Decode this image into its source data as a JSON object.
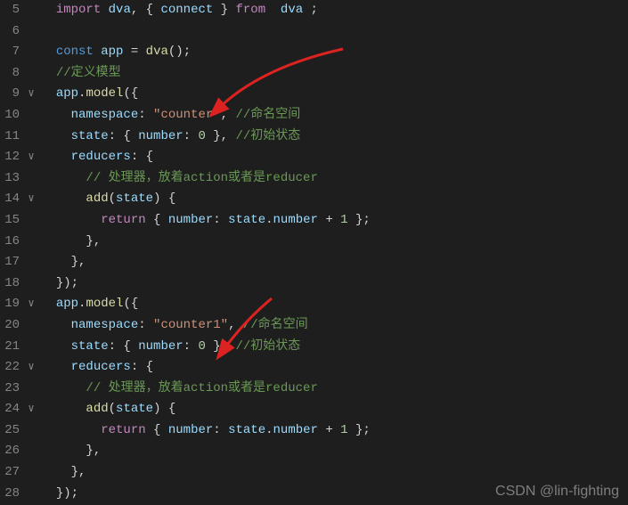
{
  "watermark": "CSDN @lin-fighting",
  "lines": [
    {
      "num": "5",
      "fold": "",
      "tokens": [
        {
          "cls": "",
          "t": "  "
        },
        {
          "cls": "kw-import",
          "t": "import"
        },
        {
          "cls": "",
          "t": " "
        },
        {
          "cls": "var",
          "t": "dva"
        },
        {
          "cls": "punct",
          "t": ", { "
        },
        {
          "cls": "var",
          "t": "connect"
        },
        {
          "cls": "punct",
          "t": " } "
        },
        {
          "cls": "kw-import",
          "t": "from"
        },
        {
          "cls": "",
          "t": "  "
        },
        {
          "cls": "var",
          "t": "dva"
        },
        {
          "cls": "punct",
          "t": " ;"
        }
      ]
    },
    {
      "num": "6",
      "fold": "",
      "tokens": []
    },
    {
      "num": "7",
      "fold": "",
      "tokens": [
        {
          "cls": "",
          "t": "  "
        },
        {
          "cls": "kw-const",
          "t": "const"
        },
        {
          "cls": "",
          "t": " "
        },
        {
          "cls": "var",
          "t": "app"
        },
        {
          "cls": "",
          "t": " "
        },
        {
          "cls": "punct",
          "t": "="
        },
        {
          "cls": "",
          "t": " "
        },
        {
          "cls": "func",
          "t": "dva"
        },
        {
          "cls": "punct",
          "t": "();"
        }
      ]
    },
    {
      "num": "8",
      "fold": "",
      "tokens": [
        {
          "cls": "",
          "t": "  "
        },
        {
          "cls": "comment",
          "t": "//定义模型"
        }
      ]
    },
    {
      "num": "9",
      "fold": "∨",
      "tokens": [
        {
          "cls": "",
          "t": "  "
        },
        {
          "cls": "var",
          "t": "app"
        },
        {
          "cls": "punct",
          "t": "."
        },
        {
          "cls": "func",
          "t": "model"
        },
        {
          "cls": "punct",
          "t": "({"
        }
      ]
    },
    {
      "num": "10",
      "fold": "",
      "tokens": [
        {
          "cls": "",
          "t": "    "
        },
        {
          "cls": "prop",
          "t": "namespace"
        },
        {
          "cls": "punct",
          "t": ": "
        },
        {
          "cls": "str",
          "t": "\"counter\""
        },
        {
          "cls": "punct",
          "t": ", "
        },
        {
          "cls": "comment",
          "t": "//命名空间"
        }
      ]
    },
    {
      "num": "11",
      "fold": "",
      "tokens": [
        {
          "cls": "",
          "t": "    "
        },
        {
          "cls": "prop",
          "t": "state"
        },
        {
          "cls": "punct",
          "t": ": { "
        },
        {
          "cls": "prop",
          "t": "number"
        },
        {
          "cls": "punct",
          "t": ": "
        },
        {
          "cls": "num",
          "t": "0"
        },
        {
          "cls": "punct",
          "t": " }, "
        },
        {
          "cls": "comment",
          "t": "//初始状态"
        }
      ]
    },
    {
      "num": "12",
      "fold": "∨",
      "tokens": [
        {
          "cls": "",
          "t": "    "
        },
        {
          "cls": "prop",
          "t": "reducers"
        },
        {
          "cls": "punct",
          "t": ": {"
        }
      ]
    },
    {
      "num": "13",
      "fold": "",
      "tokens": [
        {
          "cls": "",
          "t": "      "
        },
        {
          "cls": "comment",
          "t": "// 处理器，放着action或者是reducer"
        }
      ]
    },
    {
      "num": "14",
      "fold": "∨",
      "tokens": [
        {
          "cls": "",
          "t": "      "
        },
        {
          "cls": "func",
          "t": "add"
        },
        {
          "cls": "punct",
          "t": "("
        },
        {
          "cls": "var",
          "t": "state"
        },
        {
          "cls": "punct",
          "t": ") {"
        }
      ]
    },
    {
      "num": "15",
      "fold": "",
      "tokens": [
        {
          "cls": "",
          "t": "        "
        },
        {
          "cls": "kw-return",
          "t": "return"
        },
        {
          "cls": "punct",
          "t": " { "
        },
        {
          "cls": "prop",
          "t": "number"
        },
        {
          "cls": "punct",
          "t": ": "
        },
        {
          "cls": "var",
          "t": "state"
        },
        {
          "cls": "punct",
          "t": "."
        },
        {
          "cls": "var",
          "t": "number"
        },
        {
          "cls": "",
          "t": " "
        },
        {
          "cls": "punct",
          "t": "+"
        },
        {
          "cls": "",
          "t": " "
        },
        {
          "cls": "num",
          "t": "1"
        },
        {
          "cls": "punct",
          "t": " };"
        }
      ]
    },
    {
      "num": "16",
      "fold": "",
      "tokens": [
        {
          "cls": "",
          "t": "      "
        },
        {
          "cls": "punct",
          "t": "},"
        }
      ]
    },
    {
      "num": "17",
      "fold": "",
      "tokens": [
        {
          "cls": "",
          "t": "    "
        },
        {
          "cls": "punct",
          "t": "},"
        }
      ]
    },
    {
      "num": "18",
      "fold": "",
      "tokens": [
        {
          "cls": "",
          "t": "  "
        },
        {
          "cls": "punct",
          "t": "});"
        }
      ]
    },
    {
      "num": "19",
      "fold": "∨",
      "tokens": [
        {
          "cls": "",
          "t": "  "
        },
        {
          "cls": "var",
          "t": "app"
        },
        {
          "cls": "punct",
          "t": "."
        },
        {
          "cls": "func",
          "t": "model"
        },
        {
          "cls": "punct",
          "t": "({"
        }
      ]
    },
    {
      "num": "20",
      "fold": "",
      "tokens": [
        {
          "cls": "",
          "t": "    "
        },
        {
          "cls": "prop",
          "t": "namespace"
        },
        {
          "cls": "punct",
          "t": ": "
        },
        {
          "cls": "str",
          "t": "\"counter1\""
        },
        {
          "cls": "punct",
          "t": ", "
        },
        {
          "cls": "comment",
          "t": "//命名空间"
        }
      ]
    },
    {
      "num": "21",
      "fold": "",
      "tokens": [
        {
          "cls": "",
          "t": "    "
        },
        {
          "cls": "prop",
          "t": "state"
        },
        {
          "cls": "punct",
          "t": ": { "
        },
        {
          "cls": "prop",
          "t": "number"
        },
        {
          "cls": "punct",
          "t": ": "
        },
        {
          "cls": "num",
          "t": "0"
        },
        {
          "cls": "punct",
          "t": " }, "
        },
        {
          "cls": "comment",
          "t": "//初始状态"
        }
      ]
    },
    {
      "num": "22",
      "fold": "∨",
      "tokens": [
        {
          "cls": "",
          "t": "    "
        },
        {
          "cls": "prop",
          "t": "reducers"
        },
        {
          "cls": "punct",
          "t": ": {"
        }
      ]
    },
    {
      "num": "23",
      "fold": "",
      "tokens": [
        {
          "cls": "",
          "t": "      "
        },
        {
          "cls": "comment",
          "t": "// 处理器，放着action或者是reducer"
        }
      ]
    },
    {
      "num": "24",
      "fold": "∨",
      "tokens": [
        {
          "cls": "",
          "t": "      "
        },
        {
          "cls": "func",
          "t": "add"
        },
        {
          "cls": "punct",
          "t": "("
        },
        {
          "cls": "var",
          "t": "state"
        },
        {
          "cls": "punct",
          "t": ") {"
        }
      ]
    },
    {
      "num": "25",
      "fold": "",
      "tokens": [
        {
          "cls": "",
          "t": "        "
        },
        {
          "cls": "kw-return",
          "t": "return"
        },
        {
          "cls": "punct",
          "t": " { "
        },
        {
          "cls": "prop",
          "t": "number"
        },
        {
          "cls": "punct",
          "t": ": "
        },
        {
          "cls": "var",
          "t": "state"
        },
        {
          "cls": "punct",
          "t": "."
        },
        {
          "cls": "var",
          "t": "number"
        },
        {
          "cls": "",
          "t": " "
        },
        {
          "cls": "punct",
          "t": "+"
        },
        {
          "cls": "",
          "t": " "
        },
        {
          "cls": "num",
          "t": "1"
        },
        {
          "cls": "punct",
          "t": " };"
        }
      ]
    },
    {
      "num": "26",
      "fold": "",
      "tokens": [
        {
          "cls": "",
          "t": "      "
        },
        {
          "cls": "punct",
          "t": "},"
        }
      ]
    },
    {
      "num": "27",
      "fold": "",
      "tokens": [
        {
          "cls": "",
          "t": "    "
        },
        {
          "cls": "punct",
          "t": "},"
        }
      ]
    },
    {
      "num": "28",
      "fold": "",
      "tokens": [
        {
          "cls": "",
          "t": "  "
        },
        {
          "cls": "punct",
          "t": "});"
        }
      ]
    }
  ]
}
